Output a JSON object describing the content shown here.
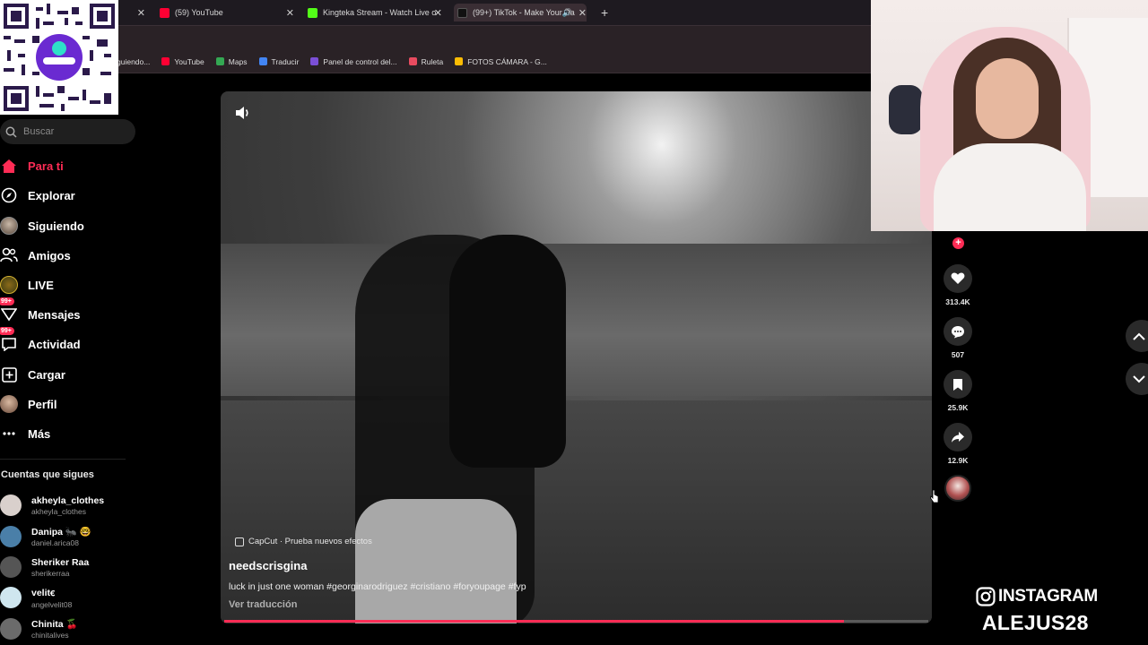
{
  "browser": {
    "tabs": [
      {
        "label": "",
        "color": "#c00"
      },
      {
        "label": "(59) YouTube",
        "color": "#ff0033"
      },
      {
        "label": "Kingteka Stream - Watch Live o",
        "color": "#53fc18"
      },
      {
        "label": "(99+) TikTok - Make Your Da",
        "color": "#111111"
      }
    ],
    "bookmarks": [
      {
        "label": "guiendo...",
        "icon": "bookmark-icon",
        "color": "#888"
      },
      {
        "label": "YouTube",
        "icon": "youtube-icon",
        "color": "#ff0033"
      },
      {
        "label": "Maps",
        "icon": "maps-icon",
        "color": "#34a853"
      },
      {
        "label": "Traducir",
        "icon": "translate-icon",
        "color": "#4285f4"
      },
      {
        "label": "Panel de control del...",
        "icon": "panel-icon",
        "color": "#7b4fd6"
      },
      {
        "label": "Ruleta",
        "icon": "wheel-icon",
        "color": "#e84b5f"
      },
      {
        "label": "FOTOS CÁMARA - G...",
        "icon": "drive-icon",
        "color": "#fbbc04"
      }
    ]
  },
  "sidebar": {
    "search_placeholder": "Buscar",
    "nav": [
      {
        "label": "Para ti",
        "icon": "home-icon",
        "active": true
      },
      {
        "label": "Explorar",
        "icon": "compass-icon"
      },
      {
        "label": "Siguiendo",
        "icon": "following-avatar-icon"
      },
      {
        "label": "Amigos",
        "icon": "friends-icon"
      },
      {
        "label": "LIVE",
        "icon": "live-icon"
      },
      {
        "label": "Mensajes",
        "icon": "messages-icon",
        "badge": "99+"
      },
      {
        "label": "Actividad",
        "icon": "activity-icon",
        "badge": "99+"
      },
      {
        "label": "Cargar",
        "icon": "upload-icon"
      },
      {
        "label": "Perfil",
        "icon": "profile-avatar-icon"
      },
      {
        "label": "Más",
        "icon": "more-icon"
      }
    ],
    "follows_title": "Cuentas que sigues",
    "accounts": [
      {
        "name": "akheyla_clothes",
        "handle": "akheyla_clothes",
        "color": "#d9d0cc"
      },
      {
        "name": "Danipa 🐜 🤓",
        "handle": "daniel.arica08",
        "color": "#4a7fa8"
      },
      {
        "name": "Sheriker Raa",
        "handle": "sherikerraa",
        "color": "#555"
      },
      {
        "name": "velitꞓ",
        "handle": "angelvelit08",
        "color": "#cfe6ef"
      },
      {
        "name": "Chinita 🍒",
        "handle": "chinitalives",
        "color": "#6b6b6b"
      }
    ]
  },
  "video": {
    "effect_label": "CapCut · Prueba nuevos efectos",
    "author": "needscrisgina",
    "caption": "luck in just one woman #georginarodriguez #cristiano #foryoupage #fyp",
    "translate_label": "Ver traducción",
    "progress": 0.88
  },
  "actions": {
    "likes": "313.4K",
    "comments": "507",
    "saves": "25.9K",
    "shares": "12.9K"
  },
  "overlay": {
    "instagram_label": "INSTAGRAM",
    "instagram_user": "ALEJUS28"
  }
}
